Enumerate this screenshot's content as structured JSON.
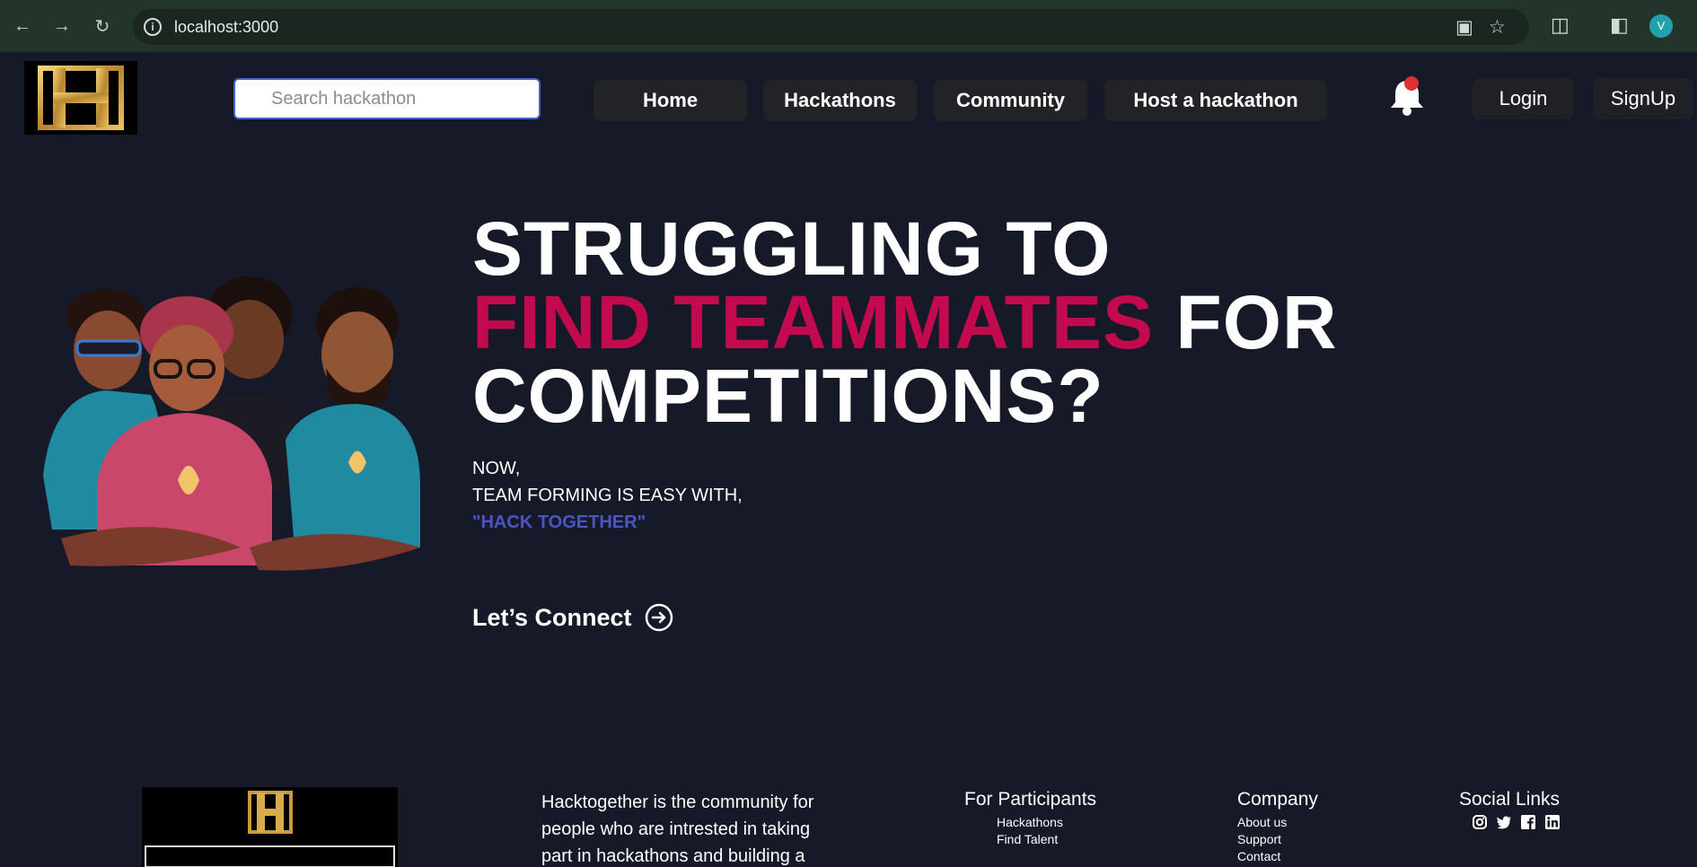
{
  "browser": {
    "url": "localhost:3000",
    "profile_initial": "V",
    "back_icon": "arrow-left-icon",
    "forward_icon": "arrow-right-icon",
    "reload_icon": "reload-icon"
  },
  "header": {
    "search_placeholder": "Search hackathon",
    "nav": [
      {
        "label": "Home"
      },
      {
        "label": "Hackathons"
      },
      {
        "label": "Community"
      },
      {
        "label": "Host a hackathon"
      }
    ],
    "login_label": "Login",
    "signup_label": "SignUp",
    "notification_dot_color": "#e03131"
  },
  "hero": {
    "line1": "STRUGGLING TO",
    "line2_accent": "FIND TEAMMATES",
    "line2_rest": "FOR",
    "line3": "COMPETITIONS?",
    "sub1": "NOW,",
    "sub2": "TEAM FORMING IS EASY WITH,",
    "brand": "\"HACK TOGETHER\"",
    "cta": "Let’s Connect",
    "accent_color": "#c40a4f",
    "brand_color": "#4d55c5"
  },
  "footer": {
    "about": "Hacktogether is the community for people who are intrested in taking part in hackathons and building a",
    "participants": {
      "heading": "For Participants",
      "links": [
        "Hackathons",
        "Find Talent"
      ]
    },
    "company": {
      "heading": "Company",
      "links": [
        "About us",
        "Support",
        "Contact"
      ]
    },
    "social": {
      "heading": "Social Links",
      "icons": [
        "instagram-icon",
        "twitter-icon",
        "facebook-icon",
        "linkedin-icon"
      ]
    }
  }
}
